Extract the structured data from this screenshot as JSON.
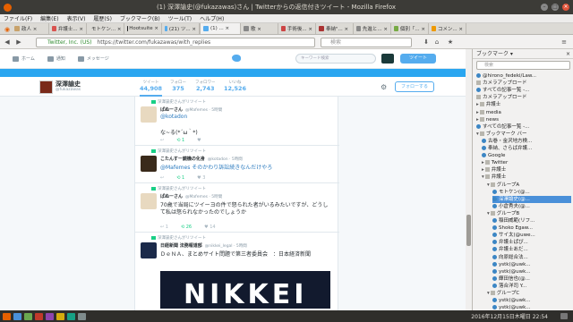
{
  "window": {
    "title": "(1) 深澤諭史(@fukazawas)さん | Twitterからの返信付きツイート - Mozilla Firefox"
  },
  "menu": [
    "ファイル(F)",
    "編集(E)",
    "表示(V)",
    "履歴(S)",
    "ブックマーク(B)",
    "ツール(T)",
    "ヘルプ(H)"
  ],
  "tabs": [
    {
      "label": "政人 ×",
      "color": "#c8a26b"
    },
    {
      "label": "弁護士... ×",
      "color": "#d9534f"
    },
    {
      "label": "モトケン... ×",
      "color": "#3c86c4"
    },
    {
      "label": "Hootsuite ×",
      "color": "#222"
    },
    {
      "label": "(21) ツ... ×",
      "color": "#55acee"
    },
    {
      "label": "(1) ... ×",
      "color": "#55acee",
      "active": true
    },
    {
      "label": "歌 ×",
      "color": "#888"
    },
    {
      "label": "手術後... ×",
      "color": "#c44"
    },
    {
      "label": "奉納\"... ×",
      "color": "#a33"
    },
    {
      "label": "先進と... ×",
      "color": "#888"
    },
    {
      "label": "個別「... ×",
      "color": "#7a4"
    },
    {
      "label": "コメン... ×",
      "color": "#e90"
    }
  ],
  "nav": {
    "url_site": "Twitter, Inc. (US)",
    "url_path": "https://twitter.com/fukazawas/with_replies",
    "search_placeholder": "検索"
  },
  "twitter": {
    "nav_home": "ホーム",
    "nav_notif": "通知",
    "nav_msg": "メッセージ",
    "search_placeholder": "キーワード検索",
    "tweet_btn": "ツイート",
    "name": "深澤諭史",
    "handle": "@fukazawas",
    "stats": [
      {
        "label": "ツイート",
        "value": "44,908"
      },
      {
        "label": "フォロー",
        "value": "375"
      },
      {
        "label": "フォロワー",
        "value": "2,743"
      },
      {
        "label": "いいね",
        "value": "12,526"
      }
    ],
    "follow_btn": "フォローする"
  },
  "tweets": [
    {
      "rt": "深澤諭史さんがリツイート",
      "name": "ぱぬーさん",
      "meta": "@Mafemes · 5時間",
      "lines": [
        "@kotadon",
        "",
        "な~る(*´ω｀*)"
      ],
      "acts": [
        "↩",
        "⟲ 1",
        "♥"
      ]
    },
    {
      "rt": "深澤諭史さんがリツイート",
      "name": "こたんすー鏡機の化身",
      "meta": "@kotadon · 5時間",
      "lines": [
        "@Mafemes そのかわり訴訟続きなんだけやろ"
      ],
      "acts": [
        "↩",
        "⟲ 1",
        "♥ 3"
      ]
    },
    {
      "rt": "深澤諭史さんがリツイート",
      "name": "ぱぬーさん",
      "meta": "@Mafemes · 5時間",
      "lines": [
        "70歳で当局にツイーヨの件で怒られた者がいるみたいですが、どうし",
        "て私は怒られなかったのでしょうか"
      ],
      "acts": [
        "↩ 1",
        "⟲ 26",
        "♥ 14"
      ]
    },
    {
      "rt": "深澤諭史さんがリツイート",
      "name": "日経新聞 法務報道部",
      "meta": "@nikkei_legal · 5時間",
      "lines": [
        "ＤｅＮＡ、まとめサイト問題で第三者委員会　：日本経済新聞"
      ],
      "image": "NIKKEI"
    }
  ],
  "sidebar": {
    "title": "ブックマーク",
    "search_placeholder": "検索",
    "items": [
      {
        "label": "@hirono_fedeki/Law...",
        "icon": "bird",
        "indent": 0
      },
      {
        "label": "カメラアップロード",
        "icon": "folder",
        "indent": 0
      },
      {
        "label": "すべての記事一覧 -...",
        "icon": "bird",
        "indent": 0
      },
      {
        "label": "カメラアップロード",
        "icon": "folder",
        "indent": 0,
        "arrow": ""
      },
      {
        "label": "弁護士",
        "icon": "folder",
        "indent": 0,
        "arrow": "r"
      },
      {
        "label": "media",
        "icon": "folder",
        "indent": 0,
        "arrow": "r"
      },
      {
        "label": "news",
        "icon": "folder",
        "indent": 0,
        "arrow": "r"
      },
      {
        "label": "すべての記事一覧 -...",
        "icon": "bird",
        "indent": 0
      },
      {
        "label": "ブックマーク バー",
        "icon": "folder",
        "indent": 0,
        "arrow": "d"
      },
      {
        "label": "古巻・金沢地方検...",
        "icon": "bird",
        "indent": 1
      },
      {
        "label": "奉納、さらば弁護...",
        "icon": "bird",
        "indent": 1
      },
      {
        "label": "Google",
        "icon": "bird",
        "indent": 1
      },
      {
        "label": "Twitter",
        "icon": "folder",
        "indent": 1,
        "arrow": "r"
      },
      {
        "label": "弁護士",
        "icon": "folder",
        "indent": 1,
        "arrow": "r"
      },
      {
        "label": "弁護士",
        "icon": "folder",
        "indent": 1,
        "arrow": "d"
      },
      {
        "label": "グループA",
        "icon": "folder",
        "indent": 2,
        "arrow": "d"
      },
      {
        "label": "モトケン(@...",
        "icon": "bird",
        "indent": 3
      },
      {
        "label": "深澤諭史(@...",
        "icon": "bird",
        "indent": 3,
        "selected": true
      },
      {
        "label": "小倉秀夫(@...",
        "icon": "bird",
        "indent": 3
      },
      {
        "label": "グループB",
        "icon": "folder",
        "indent": 2,
        "arrow": "d"
      },
      {
        "label": "稲田威範(リフ...",
        "icon": "bird",
        "indent": 3
      },
      {
        "label": "Shoko Egaw...",
        "icon": "bird",
        "indent": 3
      },
      {
        "label": "サイ太(@uwe...",
        "icon": "bird",
        "indent": 3
      },
      {
        "label": "弁護士ぱぴ...",
        "icon": "bird",
        "indent": 3
      },
      {
        "label": "弁護士あだ...",
        "icon": "bird",
        "indent": 3
      },
      {
        "label": "向原総合法...",
        "icon": "bird",
        "indent": 3
      },
      {
        "label": "ystk(@uwk...",
        "icon": "bird",
        "indent": 3
      },
      {
        "label": "ystk(@uwk...",
        "icon": "bird",
        "indent": 3
      },
      {
        "label": "輝田信也(@...",
        "icon": "bird",
        "indent": 3
      },
      {
        "label": "落合洋司 Y...",
        "icon": "bird",
        "indent": 3
      },
      {
        "label": "グループC",
        "icon": "folder",
        "indent": 2,
        "arrow": "d"
      },
      {
        "label": "ystk(@uwk...",
        "icon": "bird",
        "indent": 3
      },
      {
        "label": "ystk(@uwk...",
        "icon": "bird",
        "indent": 3
      }
    ]
  },
  "panel": {
    "clock": "2016年12月15日木曜日 22:54"
  }
}
